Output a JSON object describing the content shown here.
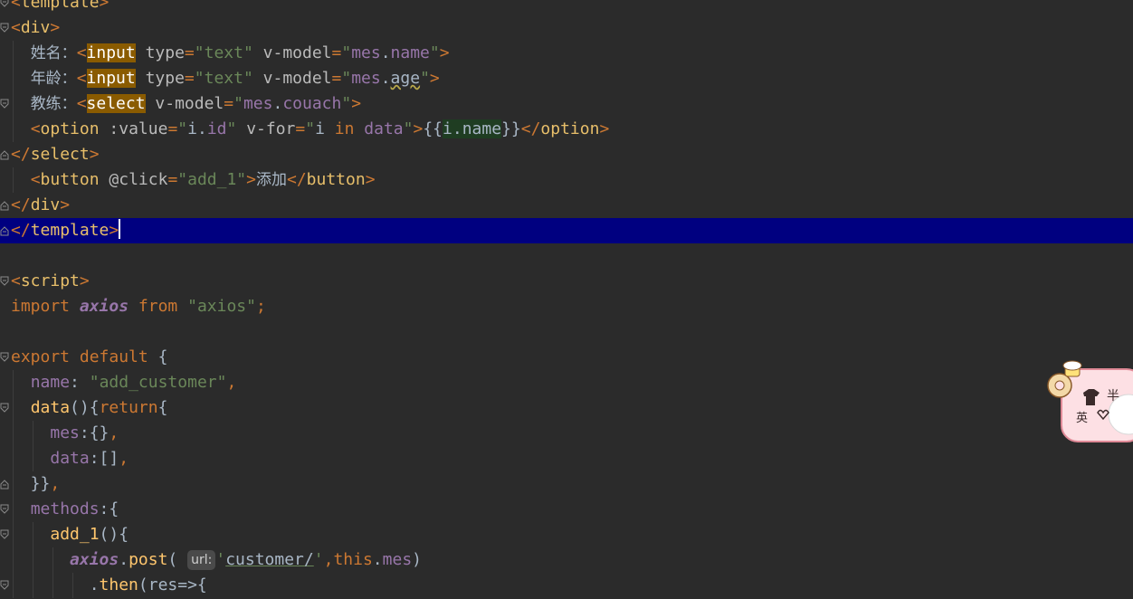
{
  "code_lines": [
    {
      "id": "l0",
      "tokens": [
        [
          "o",
          "<"
        ],
        [
          "t",
          "template"
        ],
        [
          "o",
          ">"
        ]
      ]
    },
    {
      "id": "l1",
      "tokens": [
        [
          "o",
          "<"
        ],
        [
          "t",
          "div"
        ],
        [
          "o",
          ">"
        ]
      ]
    },
    {
      "id": "l2",
      "tokens": [
        [
          "plain",
          "  "
        ],
        [
          "cjk",
          "姓名："
        ],
        [
          "o",
          "<"
        ],
        [
          "hl",
          "input"
        ],
        [
          "plain",
          " "
        ],
        [
          "a",
          "type"
        ],
        [
          "o",
          "="
        ],
        [
          "s",
          "\"text\""
        ],
        [
          "plain",
          " "
        ],
        [
          "a",
          "v-model"
        ],
        [
          "o",
          "="
        ],
        [
          "s",
          "\""
        ],
        [
          "p",
          "mes"
        ],
        [
          "plain",
          "."
        ],
        [
          "p",
          "name"
        ],
        [
          "s",
          "\""
        ],
        [
          "o",
          ">"
        ]
      ]
    },
    {
      "id": "l3",
      "tokens": [
        [
          "plain",
          "  "
        ],
        [
          "cjk",
          "年龄："
        ],
        [
          "o",
          "<"
        ],
        [
          "hl",
          "input"
        ],
        [
          "plain",
          " "
        ],
        [
          "a",
          "type"
        ],
        [
          "o",
          "="
        ],
        [
          "s",
          "\"text\""
        ],
        [
          "plain",
          " "
        ],
        [
          "a",
          "v-model"
        ],
        [
          "o",
          "="
        ],
        [
          "s",
          "\""
        ],
        [
          "p",
          "mes"
        ],
        [
          "plain",
          "."
        ],
        [
          "squig",
          "age"
        ],
        [
          "s",
          "\""
        ],
        [
          "o",
          ">"
        ]
      ]
    },
    {
      "id": "l4",
      "tokens": [
        [
          "plain",
          "  "
        ],
        [
          "cjk",
          "教练："
        ],
        [
          "o",
          "<"
        ],
        [
          "hl",
          "select"
        ],
        [
          "plain",
          " "
        ],
        [
          "a",
          "v-model"
        ],
        [
          "o",
          "="
        ],
        [
          "s",
          "\""
        ],
        [
          "p",
          "mes"
        ],
        [
          "plain",
          "."
        ],
        [
          "p",
          "couach"
        ],
        [
          "s",
          "\""
        ],
        [
          "o",
          ">"
        ]
      ]
    },
    {
      "id": "l5",
      "tokens": [
        [
          "plain",
          "  "
        ],
        [
          "o",
          "<"
        ],
        [
          "t",
          "option"
        ],
        [
          "plain",
          " "
        ],
        [
          "a",
          ":value"
        ],
        [
          "o",
          "="
        ],
        [
          "s",
          "\""
        ],
        [
          "plain",
          "i."
        ],
        [
          "p",
          "id"
        ],
        [
          "s",
          "\""
        ],
        [
          "plain",
          " "
        ],
        [
          "a",
          "v-for"
        ],
        [
          "o",
          "="
        ],
        [
          "s",
          "\""
        ],
        [
          "plain",
          "i "
        ],
        [
          "kw",
          "in"
        ],
        [
          "plain",
          " "
        ],
        [
          "p",
          "data"
        ],
        [
          "s",
          "\""
        ],
        [
          "o",
          ">"
        ],
        [
          "plain",
          "{{"
        ],
        [
          "gr",
          "i.name"
        ],
        [
          "plain",
          "}}"
        ],
        [
          "o",
          "</"
        ],
        [
          "t",
          "option"
        ],
        [
          "o",
          ">"
        ]
      ]
    },
    {
      "id": "l6",
      "tokens": [
        [
          "o",
          "</"
        ],
        [
          "t",
          "select"
        ],
        [
          "o",
          ">"
        ]
      ]
    },
    {
      "id": "l7",
      "tokens": [
        [
          "plain",
          "  "
        ],
        [
          "o",
          "<"
        ],
        [
          "t",
          "button"
        ],
        [
          "plain",
          " "
        ],
        [
          "a",
          "@click"
        ],
        [
          "o",
          "="
        ],
        [
          "s",
          "\"add_1\""
        ],
        [
          "o",
          ">"
        ],
        [
          "cjk",
          "添加"
        ],
        [
          "o",
          "</"
        ],
        [
          "t",
          "button"
        ],
        [
          "o",
          ">"
        ]
      ]
    },
    {
      "id": "l8",
      "tokens": [
        [
          "o",
          "</"
        ],
        [
          "t",
          "div"
        ],
        [
          "o",
          ">"
        ]
      ]
    },
    {
      "id": "l9",
      "current": true,
      "tokens": [
        [
          "o",
          "</"
        ],
        [
          "t",
          "template"
        ],
        [
          "o",
          ">"
        ],
        [
          "caret",
          ""
        ]
      ]
    },
    {
      "id": "l10",
      "tokens": []
    },
    {
      "id": "l11",
      "tokens": [
        [
          "o",
          "<"
        ],
        [
          "t",
          "script"
        ],
        [
          "o",
          ">"
        ]
      ]
    },
    {
      "id": "l12",
      "tokens": [
        [
          "kw",
          "import"
        ],
        [
          "plain",
          " "
        ],
        [
          "it",
          "axios"
        ],
        [
          "plain",
          " "
        ],
        [
          "kw",
          "from"
        ],
        [
          "plain",
          " "
        ],
        [
          "s",
          "\"axios\""
        ],
        [
          "kw",
          ";"
        ]
      ]
    },
    {
      "id": "l13",
      "tokens": []
    },
    {
      "id": "l14",
      "tokens": [
        [
          "kw",
          "export"
        ],
        [
          "plain",
          " "
        ],
        [
          "kw",
          "default"
        ],
        [
          "plain",
          " {"
        ]
      ]
    },
    {
      "id": "l15",
      "tokens": [
        [
          "plain",
          "  "
        ],
        [
          "p",
          "name"
        ],
        [
          "plain",
          ": "
        ],
        [
          "s",
          "\"add_customer\""
        ],
        [
          "kw",
          ","
        ]
      ]
    },
    {
      "id": "l16",
      "tokens": [
        [
          "plain",
          "  "
        ],
        [
          "fn",
          "data"
        ],
        [
          "plain",
          "(){"
        ],
        [
          "kw",
          "return"
        ],
        [
          "plain",
          "{"
        ]
      ]
    },
    {
      "id": "l17",
      "tokens": [
        [
          "plain",
          "    "
        ],
        [
          "p",
          "mes"
        ],
        [
          "plain",
          ":{}"
        ],
        [
          "kw",
          ","
        ]
      ]
    },
    {
      "id": "l18",
      "tokens": [
        [
          "plain",
          "    "
        ],
        [
          "p",
          "data"
        ],
        [
          "plain",
          ":[]"
        ],
        [
          "kw",
          ","
        ]
      ]
    },
    {
      "id": "l19",
      "tokens": [
        [
          "plain",
          "  }}"
        ],
        [
          "kw",
          ","
        ]
      ]
    },
    {
      "id": "l20",
      "tokens": [
        [
          "plain",
          "  "
        ],
        [
          "p",
          "methods"
        ],
        [
          "plain",
          ":{"
        ]
      ]
    },
    {
      "id": "l21",
      "tokens": [
        [
          "plain",
          "    "
        ],
        [
          "fn",
          "add_1"
        ],
        [
          "plain",
          "(){"
        ]
      ]
    },
    {
      "id": "l22",
      "tokens": [
        [
          "plain",
          "      "
        ],
        [
          "it",
          "axios"
        ],
        [
          "plain",
          "."
        ],
        [
          "fn",
          "post"
        ],
        [
          "plain",
          "( "
        ],
        [
          "hint",
          "url:"
        ],
        [
          "s",
          "'"
        ],
        [
          "u",
          "customer/"
        ],
        [
          "s",
          "'"
        ],
        [
          "kw",
          ","
        ],
        [
          "kw",
          "this"
        ],
        [
          "plain",
          "."
        ],
        [
          "p",
          "mes"
        ],
        [
          "plain",
          ")"
        ]
      ]
    },
    {
      "id": "l23",
      "tokens": [
        [
          "plain",
          "        ."
        ],
        [
          "fn",
          "then"
        ],
        [
          "plain",
          "(res=>{"
        ]
      ]
    }
  ],
  "hint_label": "url:",
  "sticker_text": "半 英",
  "colors": {
    "background": "#2b2b2b",
    "current_line": "#000080",
    "tag": "#e8bf6a",
    "keyword": "#cc7832",
    "string": "#6a8759",
    "property": "#9876aa"
  }
}
